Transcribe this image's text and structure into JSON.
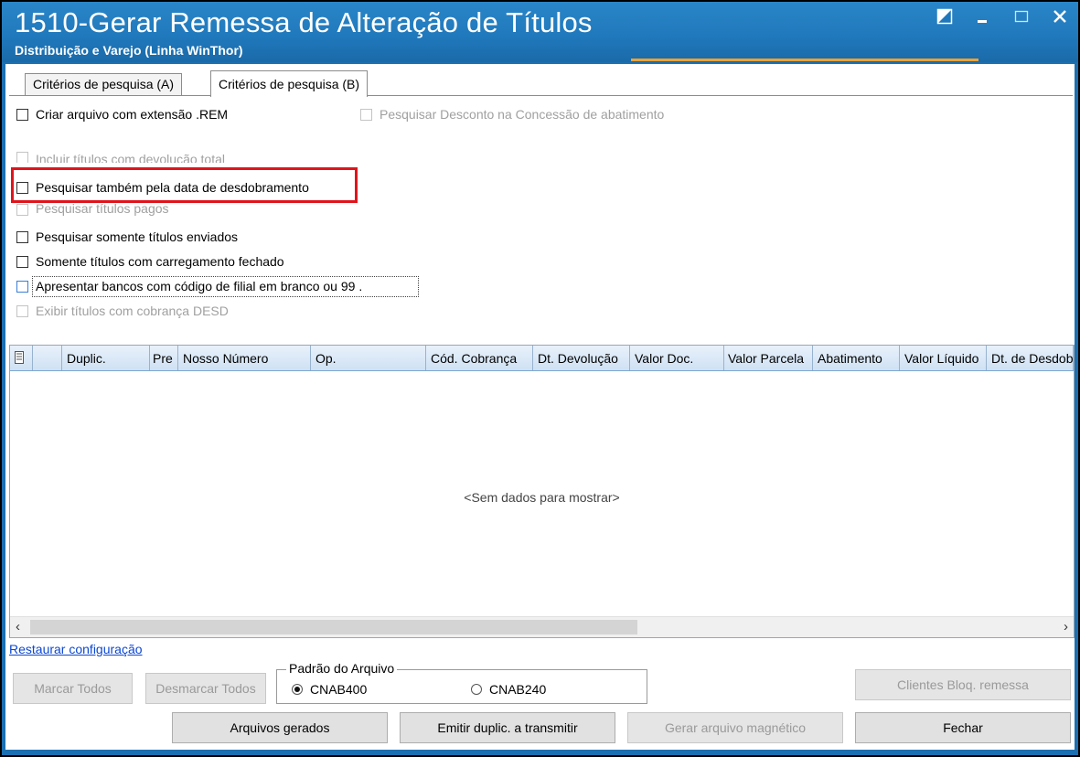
{
  "window": {
    "title": "1510-Gerar Remessa de Alteração de Títulos",
    "subtitle": "Distribuição e Varejo (Linha WinThor)",
    "controls": [
      "restore-icon",
      "minimize-icon",
      "maximize-icon",
      "close-icon"
    ]
  },
  "tabs": [
    {
      "label": "Critérios de pesquisa (A)",
      "active": false
    },
    {
      "label": "Critérios de pesquisa (B)",
      "active": true
    }
  ],
  "options": {
    "criar_arquivo_rem": {
      "label": "Criar arquivo com extensão .REM",
      "checked": false,
      "enabled": true
    },
    "pesquisar_desconto": {
      "label": "Pesquisar Desconto na Concessão de abatimento",
      "checked": false,
      "enabled": false
    },
    "incluir_devolucao": {
      "label": "Incluir títulos com devolução total",
      "checked": false,
      "enabled": false
    },
    "pesquisar_desdobramento": {
      "label": "Pesquisar também pela data de desdobramento",
      "checked": false,
      "enabled": true
    },
    "pesquisar_pagos": {
      "label": "Pesquisar títulos pagos",
      "checked": false,
      "enabled": false
    },
    "somente_enviados": {
      "label": "Pesquisar somente títulos enviados",
      "checked": false,
      "enabled": true
    },
    "carregamento_fechado": {
      "label": "Somente títulos com carregamento fechado",
      "checked": false,
      "enabled": true
    },
    "bancos_filial_branco": {
      "label": "Apresentar bancos com código de filial em branco ou 99 .",
      "checked": false,
      "enabled": true
    },
    "exibir_desd": {
      "label": "Exibir títulos com cobrança DESD",
      "checked": false,
      "enabled": false
    }
  },
  "grid": {
    "columns": [
      "Duplic.",
      "Pre",
      "Nosso Número",
      "Op.",
      "Cód. Cobrança",
      "Dt. Devolução",
      "Valor Doc.",
      "Valor Parcela",
      "Abatimento",
      "Valor Líquido",
      "Dt. de Desdobramento"
    ],
    "empty_text": "<Sem dados para mostrar>"
  },
  "restore_link": "Restaurar configuração",
  "padrao_arquivo": {
    "title": "Padrão do Arquivo",
    "options": [
      {
        "label": "CNAB400",
        "selected": true
      },
      {
        "label": "CNAB240",
        "selected": false
      }
    ]
  },
  "buttons": {
    "marcar_todos": "Marcar Todos",
    "desmarcar_todos": "Desmarcar Todos",
    "clientes_bloq": "Clientes Bloq. remessa",
    "arquivos_gerados": "Arquivos gerados",
    "emitir_duplic": "Emitir duplic. a transmitir",
    "gerar_arquivo": "Gerar arquivo magnético",
    "fechar": "Fechar"
  }
}
